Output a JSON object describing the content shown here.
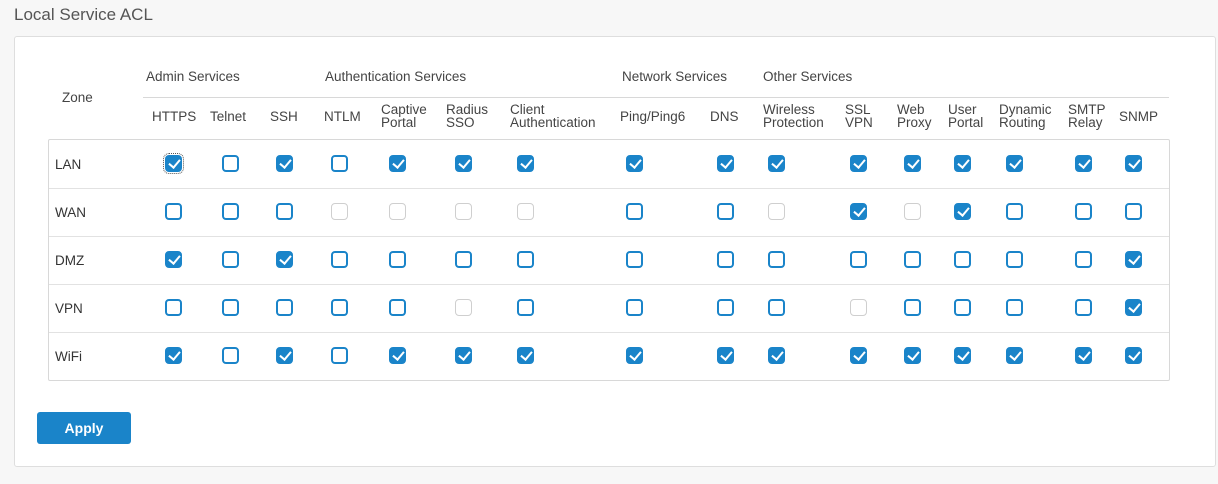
{
  "page_title": "Local Service ACL",
  "zone_header": "Zone",
  "groups": [
    {
      "label": "Admin Services"
    },
    {
      "label": "Authentication Services"
    },
    {
      "label": "Network Services"
    },
    {
      "label": "Other Services"
    }
  ],
  "columns": [
    {
      "line1": "HTTPS",
      "line2": ""
    },
    {
      "line1": "Telnet",
      "line2": ""
    },
    {
      "line1": "SSH",
      "line2": ""
    },
    {
      "line1": "NTLM",
      "line2": ""
    },
    {
      "line1": "Captive",
      "line2": "Portal"
    },
    {
      "line1": "Radius",
      "line2": "SSO"
    },
    {
      "line1": "Client",
      "line2": "Authentication"
    },
    {
      "line1": "Ping/Ping6",
      "line2": ""
    },
    {
      "line1": "DNS",
      "line2": ""
    },
    {
      "line1": "Wireless",
      "line2": "Protection"
    },
    {
      "line1": "SSL",
      "line2": "VPN"
    },
    {
      "line1": "Web",
      "line2": "Proxy"
    },
    {
      "line1": "User",
      "line2": "Portal"
    },
    {
      "line1": "Dynamic",
      "line2": "Routing"
    },
    {
      "line1": "SMTP",
      "line2": "Relay"
    },
    {
      "line1": "SNMP",
      "line2": ""
    }
  ],
  "rows": [
    {
      "zone": "LAN",
      "cells": [
        "on",
        "off",
        "on",
        "off",
        "on",
        "on",
        "on",
        "on",
        "on",
        "on",
        "on",
        "on",
        "on",
        "on",
        "on",
        "on"
      ]
    },
    {
      "zone": "WAN",
      "cells": [
        "off",
        "off",
        "off",
        "dis",
        "dis",
        "dis",
        "dis",
        "off",
        "off",
        "dis",
        "on",
        "dis",
        "on",
        "off",
        "off",
        "off"
      ]
    },
    {
      "zone": "DMZ",
      "cells": [
        "on",
        "off",
        "on",
        "off",
        "off",
        "off",
        "off",
        "off",
        "off",
        "off",
        "off",
        "off",
        "off",
        "off",
        "off",
        "on"
      ]
    },
    {
      "zone": "VPN",
      "cells": [
        "off",
        "off",
        "off",
        "off",
        "off",
        "dis",
        "off",
        "off",
        "off",
        "off",
        "dis",
        "off",
        "off",
        "off",
        "off",
        "on"
      ]
    },
    {
      "zone": "WiFi",
      "cells": [
        "on",
        "off",
        "on",
        "off",
        "on",
        "on",
        "on",
        "on",
        "on",
        "on",
        "on",
        "on",
        "on",
        "on",
        "on",
        "on"
      ]
    }
  ],
  "apply_label": "Apply",
  "colors": {
    "accent": "#1a84c9",
    "disabled_border": "#cfcfcf"
  }
}
